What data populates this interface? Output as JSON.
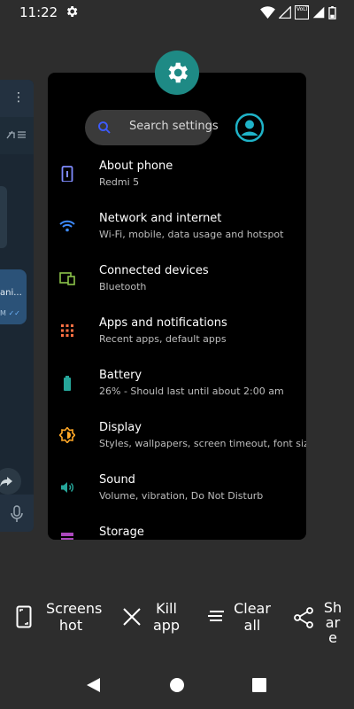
{
  "status_bar": {
    "time": "11:22",
    "volte_badge": "VoLTE"
  },
  "background_app": {
    "message_preview": "ani...",
    "message_time": "M"
  },
  "settings_card": {
    "search_placeholder": "Search settings",
    "items": [
      {
        "title": "About phone",
        "subtitle": "Redmi 5",
        "icon": "phone-info-icon",
        "color": "#7f8cff"
      },
      {
        "title": "Network and internet",
        "subtitle": "Wi-Fi, mobile, data usage and hotspot",
        "icon": "wifi-icon",
        "color": "#3d8bff"
      },
      {
        "title": "Connected devices",
        "subtitle": "Bluetooth",
        "icon": "connected-devices-icon",
        "color": "#8bc34a"
      },
      {
        "title": "Apps and notifications",
        "subtitle": "Recent apps, default apps",
        "icon": "apps-grid-icon",
        "color": "#ff7043"
      },
      {
        "title": "Battery",
        "subtitle": "26% - Should last until about 2:00 am",
        "icon": "battery-icon",
        "color": "#26a69a"
      },
      {
        "title": "Display",
        "subtitle": "Styles, wallpapers, screen timeout, font size",
        "icon": "brightness-icon",
        "color": "#ffa726"
      },
      {
        "title": "Sound",
        "subtitle": "Volume, vibration, Do Not Disturb",
        "icon": "volume-icon",
        "color": "#26a69a"
      },
      {
        "title": "Storage",
        "subtitle": "",
        "icon": "storage-icon",
        "color": "#ab47bc"
      }
    ]
  },
  "actions": [
    {
      "line1": "Screens",
      "line2": "hot",
      "icon": "screenshot-icon"
    },
    {
      "line1": "Kill",
      "line2": "app",
      "icon": "close-icon"
    },
    {
      "line1": "Clear",
      "line2": "all",
      "icon": "clear-all-icon"
    },
    {
      "line1": "Sh",
      "line2": "ar",
      "line3": "e",
      "icon": "share-icon"
    }
  ],
  "nav": {
    "back": "back-icon",
    "home": "home-icon",
    "recents": "recents-icon"
  }
}
